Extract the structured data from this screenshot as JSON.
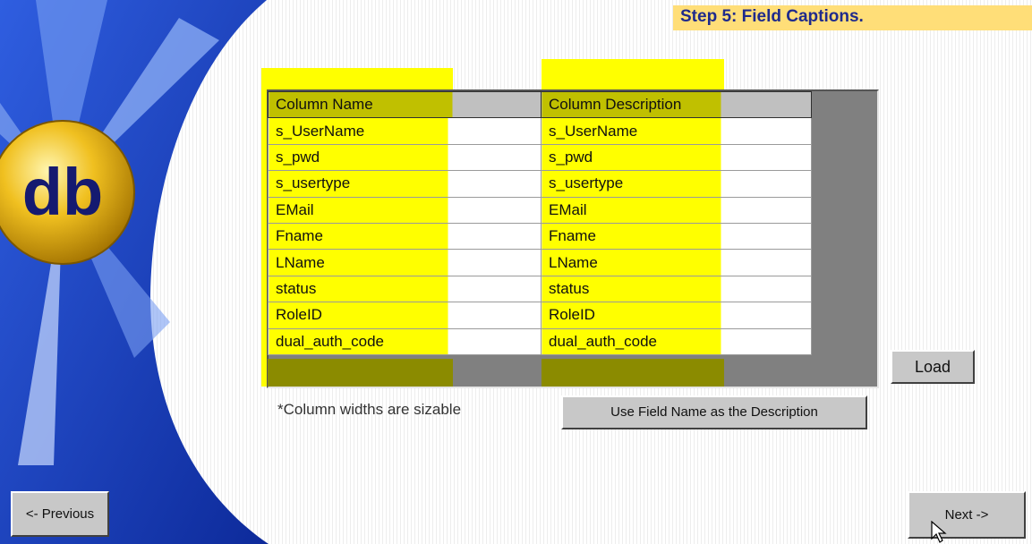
{
  "header": {
    "title": "Step 5: Field Captions."
  },
  "logo": {
    "text": "db"
  },
  "grid": {
    "headers": {
      "name": "Column Name",
      "description": "Column Description"
    },
    "rows": [
      {
        "name": "s_UserName",
        "description": "s_UserName"
      },
      {
        "name": "s_pwd",
        "description": "s_pwd"
      },
      {
        "name": "s_usertype",
        "description": "s_usertype"
      },
      {
        "name": "EMail",
        "description": "EMail"
      },
      {
        "name": "Fname",
        "description": "Fname"
      },
      {
        "name": "LName",
        "description": "LName"
      },
      {
        "name": "status",
        "description": "status"
      },
      {
        "name": "RoleID",
        "description": "RoleID"
      },
      {
        "name": "dual_auth_code",
        "description": "dual_auth_code"
      }
    ]
  },
  "buttons": {
    "load": "Load",
    "use_field_name": "Use Field Name as the Description",
    "previous": "<- Previous",
    "next": "Next ->"
  },
  "note": "*Column widths are sizable",
  "colors": {
    "highlight": "#ffff00",
    "title_bg": "#ffde78",
    "title_text": "#1f2a8c",
    "sidebar_blue": "#1a3fb8",
    "logo_gold": "#f0c020"
  }
}
